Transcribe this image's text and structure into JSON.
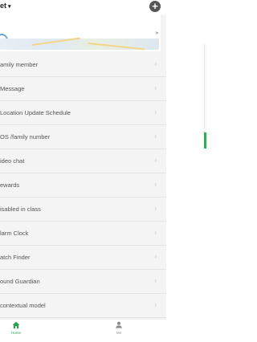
{
  "header": {
    "device_label": "et",
    "caret": "▾",
    "add_symbol": "+"
  },
  "map": {
    "corner_mark": "Þ"
  },
  "menu": {
    "chevron": "›",
    "items": [
      {
        "label": "amily member"
      },
      {
        "label": "Message"
      },
      {
        "label": "Location Update Schedule"
      },
      {
        "label": "OS /family number"
      },
      {
        "label": "ideo chat"
      },
      {
        "label": "ewards"
      },
      {
        "label": "isabled in class"
      },
      {
        "label": "larm Clock"
      },
      {
        "label": "atch Finder"
      },
      {
        "label": "ound Guardian"
      },
      {
        "label": "contextual model"
      }
    ]
  },
  "tabbar": {
    "home_label": "Home",
    "me_label": "Me",
    "home_icon": "home-icon",
    "me_icon": "person-icon"
  },
  "colors": {
    "accent_green": "#2e9e4f",
    "menu_background": "#f4f4f4",
    "separator": "#e3e3e3"
  }
}
